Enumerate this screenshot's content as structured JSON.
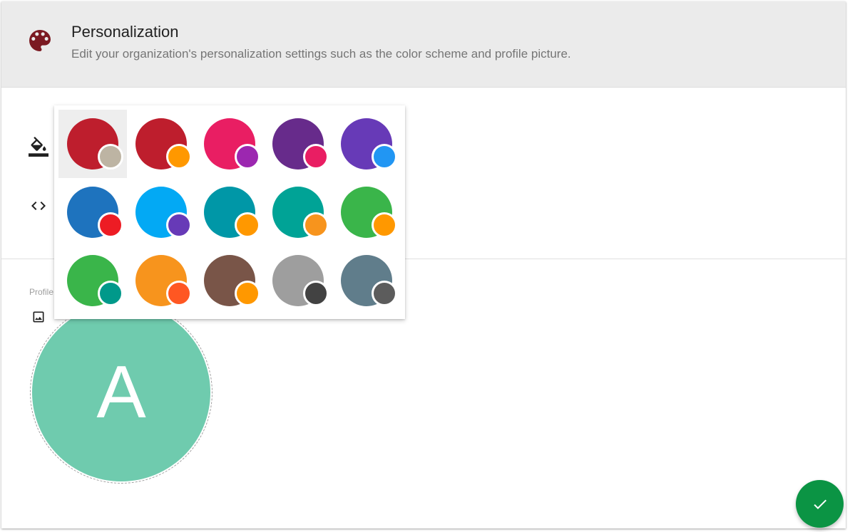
{
  "header": {
    "title": "Personalization",
    "subtitle": "Edit your organization's personalization settings such as the color scheme and profile picture.",
    "icon": "palette-icon"
  },
  "settings": {
    "color_row_icon": "format-color-fill-icon",
    "code_row_icon": "code-icon",
    "profile_label": "Profile",
    "profile_row_icon": "image-icon"
  },
  "profile": {
    "initial": "A",
    "color": "#6fcbae"
  },
  "color_picker": {
    "selected_index": 0,
    "swatches": [
      {
        "main": "#be1e2d",
        "accent": "#bdb4a3"
      },
      {
        "main": "#be1e2d",
        "accent": "#ff9800"
      },
      {
        "main": "#e91e63",
        "accent": "#9c27b0"
      },
      {
        "main": "#672b8b",
        "accent": "#e91e63"
      },
      {
        "main": "#673ab7",
        "accent": "#2196f3"
      },
      {
        "main": "#1e73be",
        "accent": "#ed1c24"
      },
      {
        "main": "#03a9f4",
        "accent": "#673ab7"
      },
      {
        "main": "#0097a7",
        "accent": "#ff9800"
      },
      {
        "main": "#00a396",
        "accent": "#f7941d"
      },
      {
        "main": "#3ab54a",
        "accent": "#ff9800"
      },
      {
        "main": "#3ab54a",
        "accent": "#00998a"
      },
      {
        "main": "#f7941d",
        "accent": "#ff5722"
      },
      {
        "main": "#795548",
        "accent": "#ff9800"
      },
      {
        "main": "#9e9e9e",
        "accent": "#424242"
      },
      {
        "main": "#607d8b",
        "accent": "#5c5c5c"
      }
    ]
  },
  "actions": {
    "save_icon": "check-icon",
    "save_color": "#0b9444"
  },
  "colors": {
    "header_bg": "#ebebeb",
    "palette_icon": "#7b1a22"
  }
}
